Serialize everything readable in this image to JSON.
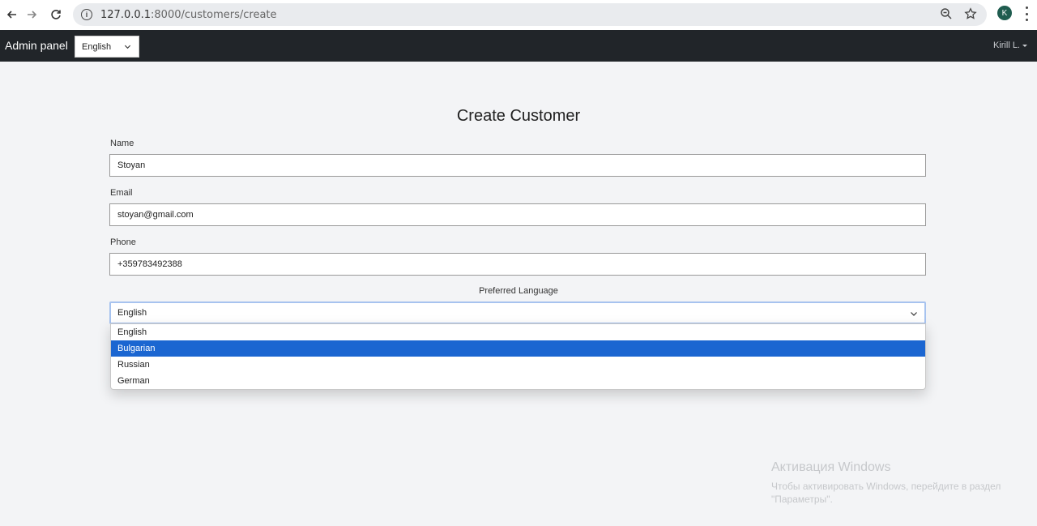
{
  "browser": {
    "url_host": "127.0.0.1",
    "url_path": ":8000/customers/create",
    "profile_initial": "K",
    "icons": [
      "back-arrow-icon",
      "forward-arrow-icon",
      "reload-icon",
      "info-icon",
      "zoom-icon",
      "star-icon",
      "menu-dots-icon"
    ]
  },
  "navbar": {
    "brand": "Admin panel",
    "language": "English",
    "user": "Kirill L."
  },
  "form": {
    "title": "Create Customer",
    "name_label": "Name",
    "name_value": "Stoyan",
    "email_label": "Email",
    "email_value": "stoyan@gmail.com",
    "phone_label": "Phone",
    "phone_value": "+359783492388",
    "language_label": "Preferred Language",
    "language_value": "English",
    "language_options": [
      "English",
      "Bulgarian",
      "Russian",
      "German"
    ],
    "highlighted_option": "Bulgarian"
  },
  "watermark": {
    "title": "Активация Windows",
    "text": "Чтобы активировать Windows, перейдите в раздел \"Параметры\"."
  },
  "colors": {
    "navbar_bg": "#212529",
    "page_bg": "#f3f4f6",
    "highlight": "#1b66d1"
  }
}
